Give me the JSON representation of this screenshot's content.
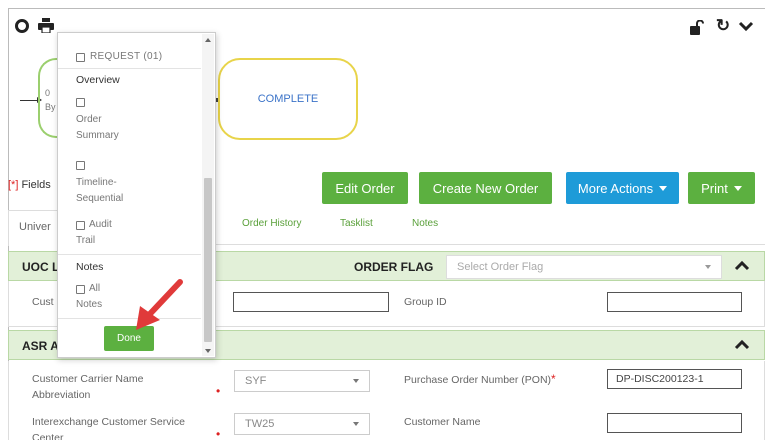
{
  "workflow": {
    "partial_lines": [
      "0",
      "By"
    ],
    "complete_label": "COMPLETE"
  },
  "legend": {
    "star": "[*]",
    "text": " Fields"
  },
  "actions": {
    "edit_order": "Edit Order",
    "create_new_order": "Create New Order",
    "more_actions": "More Actions",
    "print": "Print"
  },
  "tabs": {
    "univ": "Univer",
    "order_history": "Order History",
    "tasklist": "Tasklist",
    "notes": "Notes"
  },
  "uoc": {
    "title": "UOC L",
    "order_flag_label": "ORDER FLAG",
    "order_flag_placeholder": "Select Order Flag",
    "cust_label": "Cust",
    "cust_value": "",
    "group_id_label": "Group ID",
    "group_id_value": ""
  },
  "asr": {
    "title": "ASR A",
    "ccna_label_1": "Customer Carrier Name",
    "ccna_label_2": "Abbreviation",
    "ccna_value": "SYF",
    "pon_label": "Purchase Order Number (PON)",
    "pon_value": "DP-DISC200123-1",
    "ics_label_1": "Interexchange Customer Service",
    "ics_label_2": "Center",
    "ics_value": "TW25",
    "customer_name_label": "Customer Name",
    "customer_name_value": ""
  },
  "panel": {
    "request_label": "REQUEST (01)",
    "overview_heading": "Overview",
    "order_summary_1": "Order",
    "order_summary_2": "Summary",
    "timeline_1": "Timeline-",
    "timeline_2": "Sequential",
    "audit_1": "Audit",
    "audit_2": "Trail",
    "notes_heading": "Notes",
    "all_notes_1": "All",
    "all_notes_2": "Notes",
    "done_label": "Done"
  },
  "colors": {
    "green": "#5cb040",
    "blue": "#1e9bd8",
    "section_bg": "#e2f0d8",
    "arrow": "#e03a3a",
    "complete_border": "#e8d44a"
  },
  "icons": [
    "circle-icon",
    "printer-icon",
    "lock-icon",
    "refresh-icon",
    "chevron-down-icon",
    "chevron-up-icon"
  ]
}
